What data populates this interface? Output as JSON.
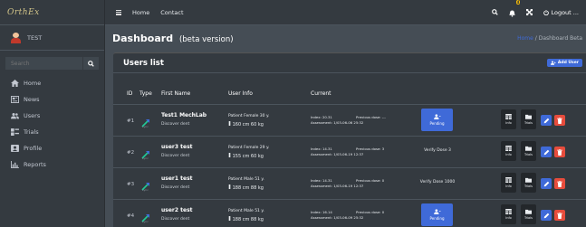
{
  "brand": {
    "logo_text": "OrthEx"
  },
  "user": {
    "name": "TEST"
  },
  "sidebar": {
    "search_placeholder": "Search",
    "items": [
      {
        "label": "Home",
        "icon": "home-icon"
      },
      {
        "label": "News",
        "icon": "news-icon"
      },
      {
        "label": "Users",
        "icon": "users-icon"
      },
      {
        "label": "Trials",
        "icon": "trials-icon"
      },
      {
        "label": "Profile",
        "icon": "profile-icon"
      },
      {
        "label": "Reports",
        "icon": "chart-icon"
      }
    ]
  },
  "topbar": {
    "links": [
      "Home",
      "Contact"
    ],
    "notification_count": "4",
    "logout_label": "Logout ..."
  },
  "header": {
    "title": "Dashboard",
    "subtitle": "(beta version)",
    "breadcrumb_home": "Home",
    "breadcrumb_sep": "/",
    "breadcrumb_current": "Dashboard Beta"
  },
  "card": {
    "title": "Users list",
    "add_button": "Add User"
  },
  "table": {
    "columns": [
      "ID",
      "Type",
      "First Name",
      "User Info",
      "Current"
    ],
    "action_labels": {
      "info": "Info",
      "trials": "Trials",
      "pending": "Pending"
    },
    "rows": [
      {
        "id": "#1",
        "type_label": "sync",
        "first_name": "Test1 MechLab",
        "last_name": "Discover dent",
        "patient_line": "Patient  Female  30 y.",
        "size_line": "160 cm  60 kg",
        "cur_line1": "Index: 20.31",
        "cur_line2": "Assessment: 1/03-06-06 25:32",
        "prev_line": "Previous dose: ---",
        "status": "Pending",
        "status_is_button": true
      },
      {
        "id": "#2",
        "type_label": "sync",
        "first_name": "user3 test",
        "last_name": "Discover dent",
        "patient_line": "Patient  Female  29 y.",
        "size_line": "155 cm  60 kg",
        "cur_line1": "Index: 14.31",
        "cur_line2": "Assessment: 1/03-06-19 12:37",
        "prev_line": "Previous dose: 3",
        "status": "Verify Dose 3",
        "status_is_button": false
      },
      {
        "id": "#3",
        "type_label": "sync",
        "first_name": "user1 test",
        "last_name": "Discover dent",
        "patient_line": "Patient  Male  51 y.",
        "size_line": "188 cm  88 kg",
        "cur_line1": "Index: 14.31",
        "cur_line2": "Assessment: 1/03-06-19 12:37",
        "prev_line": "Previous dose: 0",
        "status": "Verify Dose 1000",
        "status_is_button": false
      },
      {
        "id": "#4",
        "type_label": "sync",
        "first_name": "user2 test",
        "last_name": "Discover dent",
        "patient_line": "Patient  Male  51 y.",
        "size_line": "188 cm  88 kg",
        "cur_line1": "Index: 16.14",
        "cur_line2": "Assessment: 1/03-06-09 25:32",
        "prev_line": "Previous dose: 0",
        "status": "Pending",
        "status_is_button": true
      }
    ]
  },
  "colors": {
    "sidebar_bg": "#343a40",
    "content_bg": "#454d55",
    "primary": "#3f6ad8",
    "danger": "#e74c3c",
    "badge": "#ffc107",
    "type_icon": "#20c997"
  }
}
